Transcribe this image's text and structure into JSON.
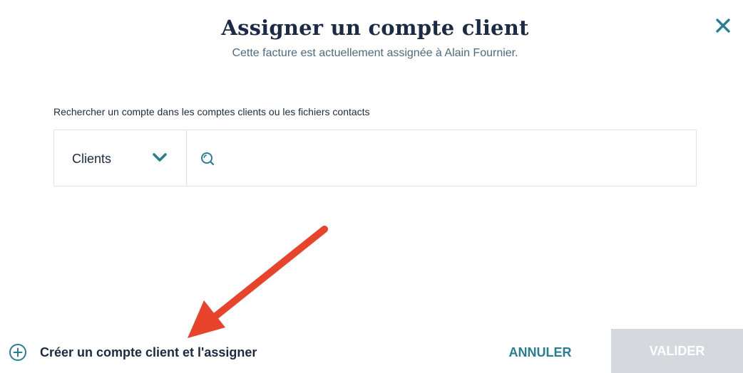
{
  "dialog": {
    "title": "Assigner un compte client",
    "subtitle": "Cette facture est actuellement assignée à Alain Fournier.",
    "close_icon": "close-icon"
  },
  "search": {
    "label": "Rechercher un compte dans les comptes clients ou les fichiers contacts",
    "type_selected": "Clients",
    "placeholder": "",
    "value": ""
  },
  "footer": {
    "create_label": "Créer un compte client et l'assigner",
    "cancel_label": "ANNULER",
    "validate_label": "VALIDER",
    "validate_disabled": true
  },
  "colors": {
    "accent": "#2a7e92",
    "title": "#1b2a45",
    "annotation_arrow": "#e8432b",
    "disabled_button": "#d5d9de"
  }
}
